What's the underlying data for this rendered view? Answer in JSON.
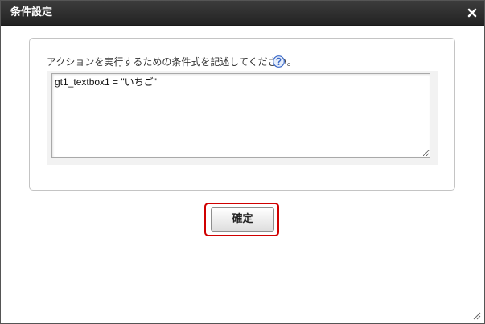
{
  "dialog": {
    "title": "条件設定",
    "close_icon": "close-icon"
  },
  "panel": {
    "instruction": "アクションを実行するための条件式を記述してください。",
    "help_icon": "question-mark-icon",
    "condition_value": "gt1_textbox1 = \"いちご\""
  },
  "footer": {
    "confirm_label": "確定"
  },
  "colors": {
    "titlebar": "#2e2e2e",
    "highlight": "#d00000",
    "help_icon": "#3b69c7"
  }
}
